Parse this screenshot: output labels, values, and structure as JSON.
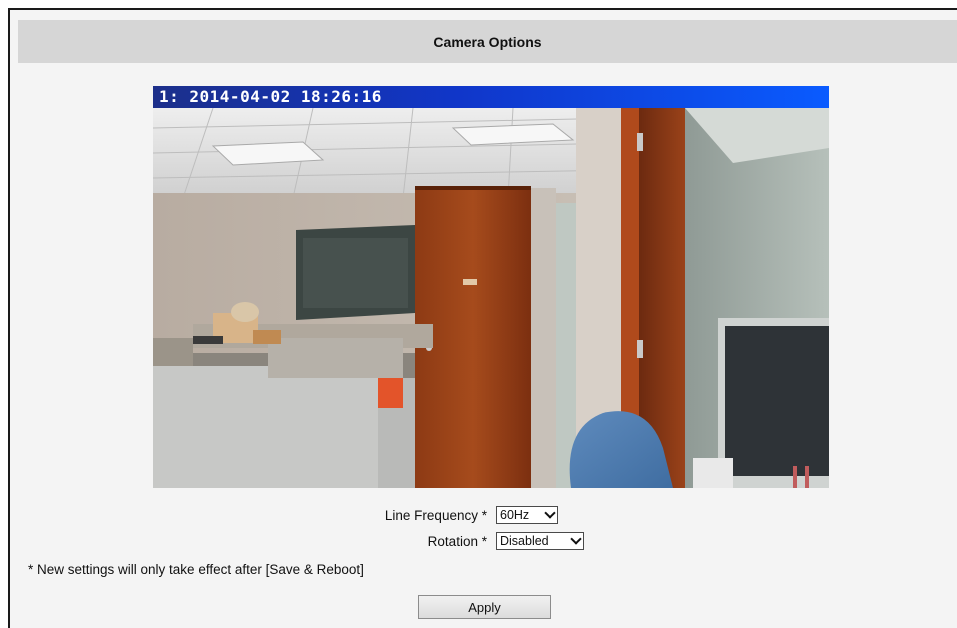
{
  "header": {
    "title": "Camera Options"
  },
  "camera": {
    "osd_text": "1:  2014-04-02 18:26:16",
    "osd_color": "#1036c9"
  },
  "form": {
    "line_frequency": {
      "label": "Line Frequency",
      "required_marker": "*",
      "value": "60Hz"
    },
    "rotation": {
      "label": "Rotation",
      "required_marker": "*",
      "value": "Disabled"
    }
  },
  "note": "* New settings will only take effect after [Save & Reboot]",
  "apply_label": "Apply"
}
